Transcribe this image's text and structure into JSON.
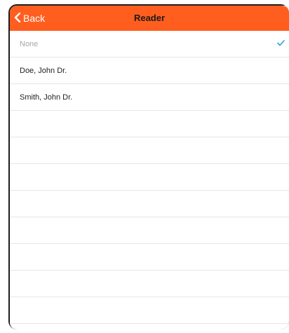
{
  "navbar": {
    "back_label": "Back",
    "title": "Reader",
    "background_color": "#ff5e1f"
  },
  "list": {
    "items": [
      {
        "label": "None",
        "selected": true
      },
      {
        "label": "Doe, John Dr.",
        "selected": false
      },
      {
        "label": "Smith, John Dr.",
        "selected": false
      }
    ],
    "checkmark_color": "#2aa0d6"
  },
  "icons": {
    "back": "chevron-left-icon",
    "selected": "checkmark-icon"
  }
}
